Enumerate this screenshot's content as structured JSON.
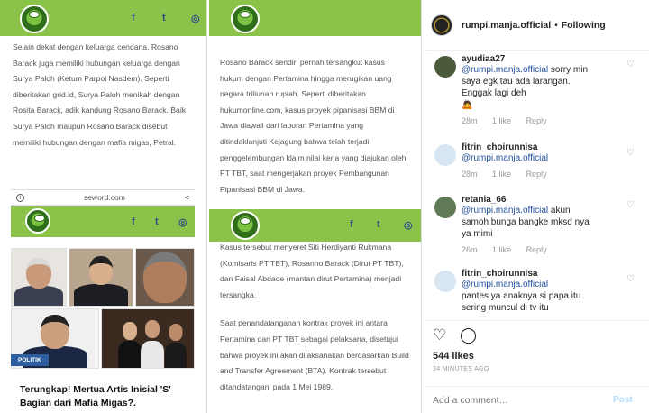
{
  "panel1": {
    "social": {
      "facebook": "f",
      "twitter": "t",
      "instagram": "◎"
    },
    "text": "Selain dekat dengan keluarga cendana, Rosano Barack juga memiliki hubungan keluarga dengan Surya Paloh (Ketum Parpol Nasdem). Seperti diberitakan grid.id, Surya Paloh menikah dengan Rosita Barack, adik kandung Rosano Barack. Baik Surya Paloh maupun Rosano Barack disebut memiliki hubungan dengan mafia migas, Petral.",
    "browser_url": "seword.com",
    "badge": "POLITIK",
    "headline": "Terungkap! Mertua Artis Inisial 'S' Bagian dari Mafia Migas?."
  },
  "panel2": {
    "text_top": "Rosano Barack sendiri pernah tersangkut kasus hukum dengan Pertamina hingga merugikan uang negara triliunan rupiah. Seperti diberitakan hukumonline.com, kasus proyek pipanisasi BBM di Jawa diawali dari laporan Pertamina yang ditindaklanjuti Kejagung bahwa telah terjadi penggelembungan klaim nilai kerja yang diajukan oleh PT TBT, saat mengerjakan proyek Pembangunan Pipanisasi BBM di Jawa.",
    "text_bottom_1": "Kasus tersebut menyeret Siti Herdiyanti Rukmana (Komisaris PT TBT), Rosanno Barack (Dirut PT TBT), dan Faisal Abdaoe (mantan dirut Pertamina) menjadi tersangka.",
    "text_bottom_2": "Saat penandatanganan kontrak proyek ini antara Pertamina dan PT TBT sebagai pelaksana, disetujui bahwa proyek ini akan dilaksanakan berdasarkan Build and Transfer Agreement (BTA). Kontrak tersebut ditandatangani pada 1 Mei 1989."
  },
  "instagram": {
    "username": "rumpi.manja.official",
    "separator": "•",
    "follow_status": "Following",
    "comments": [
      {
        "user": "ayudiaa27",
        "mention": "@rumpi.manja.official",
        "text": " sorry min saya egk tau ada larangan. Enggak lagi deh",
        "emoji": "🙇",
        "time": "28m",
        "likes": "1 like",
        "reply": "Reply"
      },
      {
        "user": "fitrin_choirunnisa",
        "mention": "@rumpi.manja.official",
        "text": "",
        "time": "28m",
        "likes": "1 like",
        "reply": "Reply"
      },
      {
        "user": "retania_66",
        "mention": "@rumpi.manja.official",
        "text": " akun samoh bunga bangke mksd nya ya mimi",
        "time": "26m",
        "likes": "1 like",
        "reply": "Reply"
      },
      {
        "user": "fitrin_choirunnisa",
        "mention": "@rumpi.manja.official",
        "text": "pantes ya anaknya si papa itu sering muncul di tv itu",
        "time": "",
        "likes": "",
        "reply": ""
      }
    ],
    "likes": "544 likes",
    "time_ago": "34 MINUTES AGO",
    "comment_placeholder": "Add a comment…",
    "post_label": "Post"
  }
}
